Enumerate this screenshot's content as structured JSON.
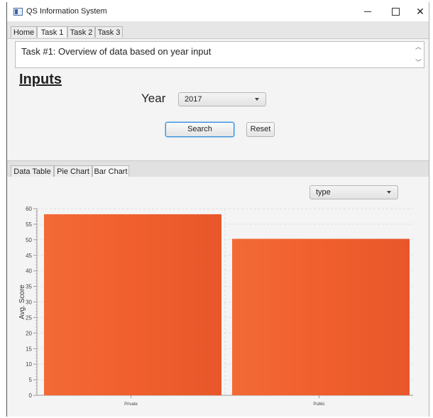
{
  "window": {
    "title": "QS Information System",
    "minimize_label": "",
    "maximize_label": "",
    "close_label": "✕"
  },
  "top_tabs": [
    {
      "label": "Home"
    },
    {
      "label": "Task 1"
    },
    {
      "label": "Task 2"
    },
    {
      "label": "Task 3"
    }
  ],
  "task": {
    "description": "Task #1: Overview of data based on year input"
  },
  "inputs": {
    "heading": "Inputs",
    "year_label": "Year",
    "year_value": "2017",
    "search_label": "Search",
    "reset_label": "Reset"
  },
  "bottom_tabs": [
    {
      "label": "Data Table"
    },
    {
      "label": "Pie Chart"
    },
    {
      "label": "Bar Chart"
    }
  ],
  "chart_controls": {
    "type_select_value": "type"
  },
  "chart_data": {
    "type": "bar",
    "categories": [
      "Private",
      "Public"
    ],
    "values": [
      58.2,
      50.3
    ],
    "xlabel": "",
    "ylabel": "Avg. Score",
    "ylim": [
      0,
      60
    ],
    "yticks": [
      0,
      5,
      10,
      15,
      20,
      25,
      30,
      35,
      40,
      45,
      50,
      55,
      60
    ],
    "grid": true,
    "bar_color": "#f05f2d"
  }
}
